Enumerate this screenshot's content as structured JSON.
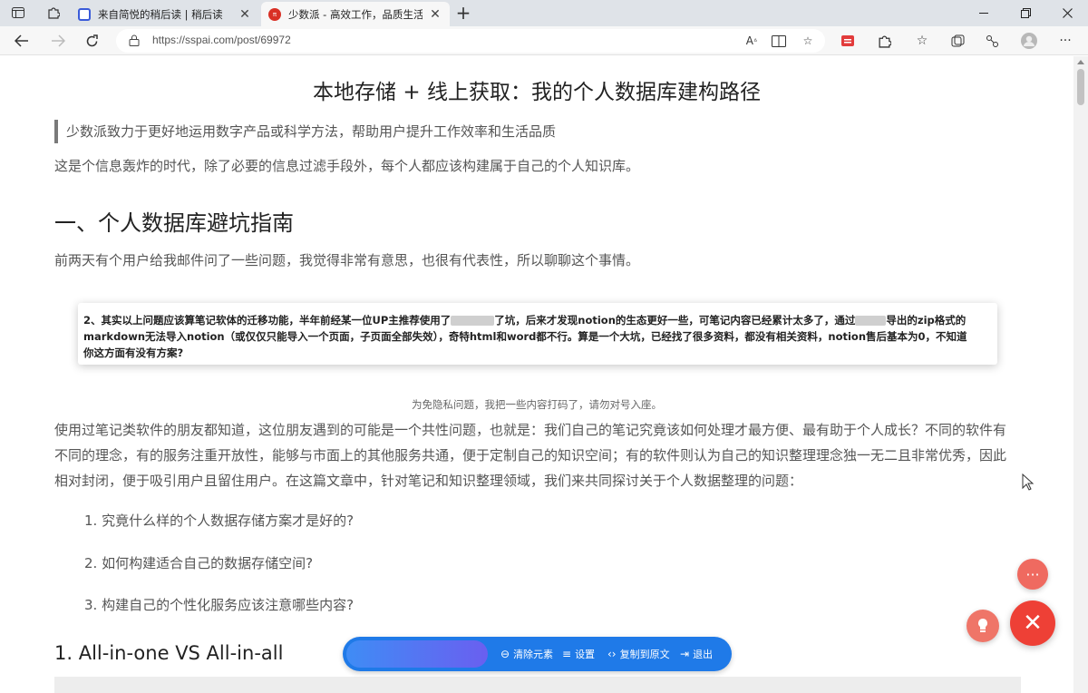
{
  "browser": {
    "tabs": [
      {
        "title": "来自简悦的稍后读 | 稍后读",
        "favicon_color": "#3a5bd9"
      },
      {
        "title": "少数派 - 高效工作，品质生活",
        "favicon_color": "#d93025"
      }
    ],
    "url": "https://sspai.com/post/69972"
  },
  "article": {
    "title": "本地存储 + 线上获取：我的个人数据库建构路径",
    "quote": "少数派致力于更好地运用数字产品或科学方法，帮助用户提升工作效率和生活品质",
    "intro": "这是个信息轰炸的时代，除了必要的信息过滤手段外，每个人都应该构建属于自己的个人知识库。",
    "section_heading": "一、个人数据库避坑指南",
    "section_intro": "前两天有个用户给我邮件问了一些问题，我觉得非常有意思，也很有代表性，所以聊聊这个事情。",
    "email_card": {
      "line1_a": "2、其实以上问题应该算笔记软体的迁移功能，半年前经某一位UP主推荐使用了",
      "line1_b": "了坑，后来才发现notion的生态更好一些，可笔记内容已经累计太多了，通过",
      "line1_c": "导出的zip格式的",
      "line2": "markdown无法导入notion（或仅仅只能导入一个页面，子页面全部失效），奇特html和word都不行。算是一个大坑，已经找了很多资料，都没有相关资料，notion售后基本为0，不知道",
      "line3": "你这方面有没有方案?"
    },
    "caption": "为免隐私问题，我把一些内容打码了，请勿对号入座。",
    "body": "使用过笔记类软件的朋友都知道，这位朋友遇到的可能是一个共性问题，也就是：我们自己的笔记究竟该如何处理才最方便、最有助于个人成长？不同的软件有不同的理念，有的服务注重开放性，能够与市面上的其他服务共通，便于定制自己的知识空间；有的软件则认为自己的知识整理理念独一无二且非常优秀，因此相对封闭，便于吸引用户且留住用户。在这篇文章中，针对笔记和知识整理领域，我们来共同探讨关于个人数据整理的问题：",
    "list": [
      "1. 究竟什么样的个人数据存储方案才是好的?",
      "2. 如何构建适合自己的数据存储空间?",
      "3. 构建自己的个性化服务应该注意哪些内容?"
    ],
    "subheading": "1. All-in-one VS All-in-all"
  },
  "reader_toolbar": {
    "clear": "清除元素",
    "settings": "设置",
    "copy": "复制到原文",
    "exit": "退出"
  },
  "colors": {
    "accent_blue": "#1f7ae8",
    "fab_red": "#ee4036"
  }
}
